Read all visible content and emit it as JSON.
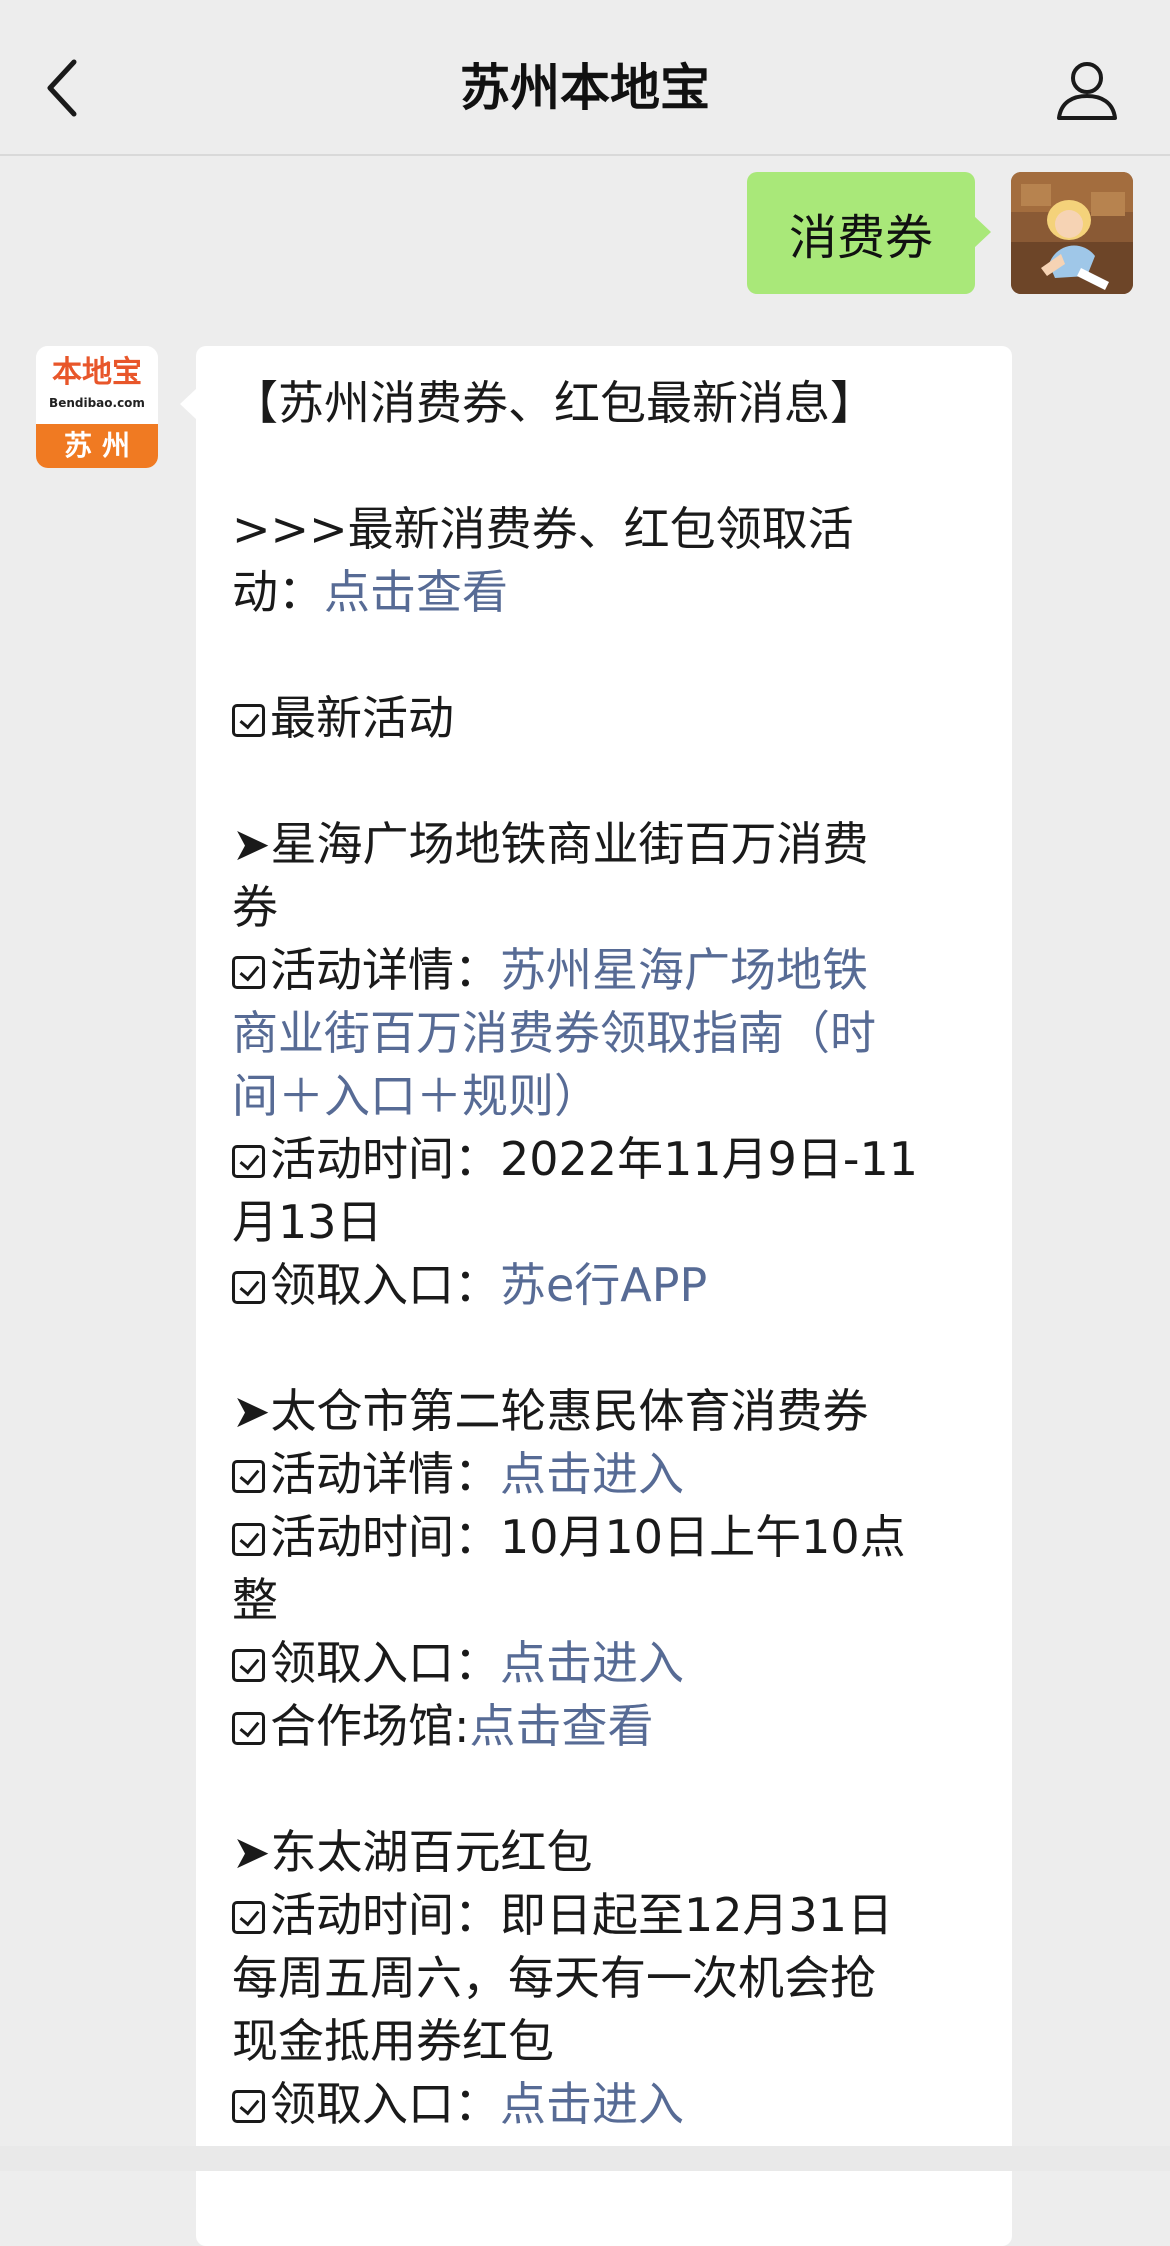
{
  "nav": {
    "title": "苏州本地宝",
    "back_icon": "chevron-left-icon",
    "profile_icon": "person-icon"
  },
  "outgoing": {
    "text": "消费券",
    "bubble_color": "#a9e879"
  },
  "bot": {
    "logo_main": "本地宝",
    "logo_sub": "Bendibao.com",
    "logo_city": "苏州"
  },
  "message": {
    "title": "【苏州消费券、红包最新消息】",
    "intro_1": ">>>最新消费券、红包领取活",
    "intro_2_prefix": "动：",
    "intro_2_link": "点击查看",
    "section_heading": "最新活动",
    "events": [
      {
        "name_1": "➤星海广场地铁商业街百万消费",
        "name_2": "券",
        "detail_label": "活动详情：",
        "detail_link_1": "苏州星海广场地铁",
        "detail_link_2": "商业街百万消费券领取指南（时",
        "detail_link_3": "间＋入口＋规则）",
        "time_label": "活动时间：",
        "time_1": "2022年11月9日-11",
        "time_2": "月13日",
        "entry_label": "领取入口：",
        "entry_link": "苏e行APP"
      },
      {
        "name_1": "➤太仓市第二轮惠民体育消费券",
        "detail_label": "活动详情：",
        "detail_link_1": "点击进入",
        "time_label": "活动时间：",
        "time_1": "10月10日上午10点",
        "time_2": "整",
        "entry_label": "领取入口：",
        "entry_link": "点击进入",
        "venue_label": "合作场馆:",
        "venue_link": "点击查看"
      },
      {
        "name_1": "➤东太湖百元红包",
        "time_label": "活动时间：",
        "time_1": "即日起至12月31日",
        "time_2": "每周五周六，每天有一次机会抢",
        "time_3": "现金抵用券红包",
        "entry_label": "领取入口：",
        "entry_link": "点击进入"
      }
    ]
  },
  "colors": {
    "link": "#576b95",
    "background": "#ededed",
    "bubble_in": "#ffffff"
  }
}
